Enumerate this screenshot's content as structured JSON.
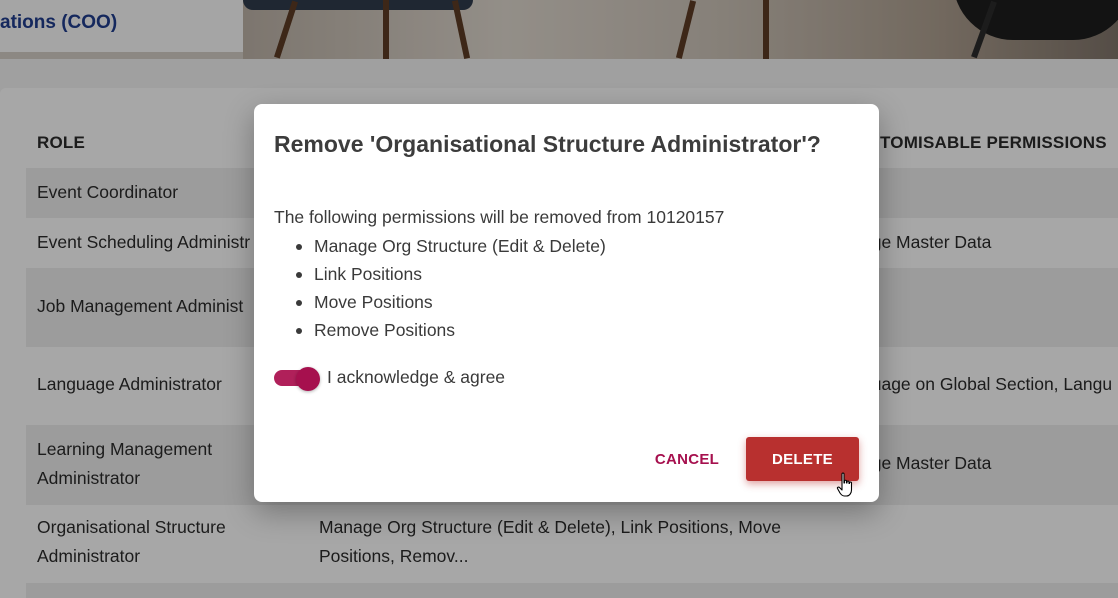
{
  "header": {
    "title_fragment": "ations (COO)"
  },
  "table": {
    "columns": {
      "role": "ROLE",
      "customisable": "TOMISABLE PERMISSIONS"
    },
    "rows": [
      {
        "role": "Event Coordinator",
        "perm": "",
        "custom": ""
      },
      {
        "role": "Event Scheduling Administr",
        "perm": "",
        "custom": "age Master Data"
      },
      {
        "role": "Job Management Administ",
        "perm": "",
        "custom": ""
      },
      {
        "role": "Language Administrator",
        "perm": "",
        "custom": "guage on Global Section, Langu"
      },
      {
        "role": "Learning Management Administrator",
        "perm": "",
        "custom": "age Master Data"
      },
      {
        "role": "Organisational Structure Administrator",
        "perm": "Manage Org Structure (Edit & Delete), Link Positions, Move Positions, Remov...",
        "custom": ""
      }
    ]
  },
  "dialog": {
    "title": "Remove 'Organisational Structure Administrator'?",
    "intro": "The following permissions will be removed from 10120157",
    "permissions": [
      "Manage Org Structure (Edit & Delete)",
      "Link Positions",
      "Move Positions",
      "Remove Positions"
    ],
    "acknowledge": {
      "label": "I acknowledge & agree",
      "checked": true
    },
    "cancel_label": "CANCEL",
    "delete_label": "DELETE"
  },
  "colors": {
    "accent": "#a6104e",
    "danger": "#b8302f",
    "header_title": "#1f3b8a"
  },
  "icons": {
    "cursor": "hand-pointer-icon"
  }
}
